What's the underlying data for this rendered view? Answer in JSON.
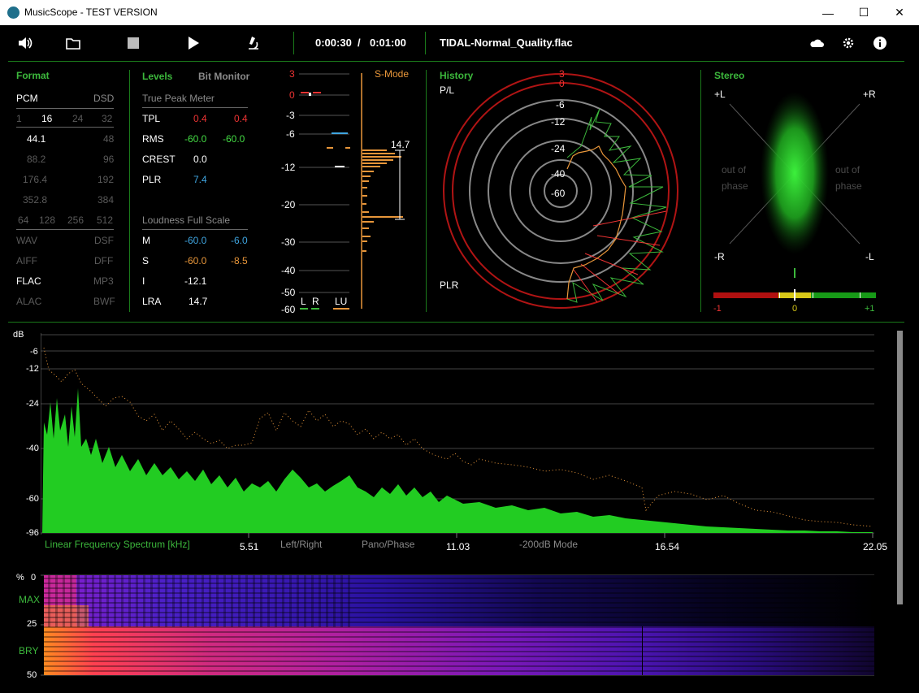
{
  "window": {
    "title": "MusicScope - TEST VERSION",
    "minimize_glyph": "—",
    "maximize_glyph": "☐",
    "close_glyph": "✕"
  },
  "toolbar": {
    "icons": [
      "volume-icon",
      "folder-icon",
      "stop-icon",
      "play-icon",
      "microscope-icon",
      "cloud-icon",
      "gear-icon",
      "info-icon"
    ],
    "position": "0:00:30",
    "separator": "/",
    "duration": "0:01:00",
    "filename": "TIDAL-Normal_Quality.flac"
  },
  "format": {
    "heading": "Format",
    "pcm": "PCM",
    "dsd": "DSD",
    "bits": [
      "1",
      "16",
      "24",
      "32"
    ],
    "rates_left": [
      "44.1",
      "88.2",
      "176.4",
      "352.8"
    ],
    "rates_right": [
      "48",
      "96",
      "192",
      "384"
    ],
    "dsd_rates": [
      "64",
      "128",
      "256",
      "512"
    ],
    "containers_left": [
      "WAV",
      "AIFF",
      "FLAC",
      "ALAC"
    ],
    "containers_right": [
      "DSF",
      "DFF",
      "MP3",
      "BWF"
    ]
  },
  "levels": {
    "heading": "Levels",
    "bit_monitor": "Bit Monitor",
    "true_peak_heading": "True Peak Meter",
    "tpl": {
      "label": "TPL",
      "left": "0.4",
      "right": "0.4"
    },
    "rms": {
      "label": "RMS",
      "left": "-60.0",
      "right": "-60.0"
    },
    "crest": {
      "label": "CREST",
      "value": "0.0"
    },
    "plr": {
      "label": "PLR",
      "value": "7.4"
    },
    "loudness_heading": "Loudness Full Scale",
    "m": {
      "label": "M",
      "left": "-60.0",
      "right": "-6.0"
    },
    "s": {
      "label": "S",
      "left": "-60.0",
      "right": "-8.5"
    },
    "i": {
      "label": "I",
      "value": "-12.1"
    },
    "lra": {
      "label": "LRA",
      "value": "14.7"
    }
  },
  "meter": {
    "smode": "S-Mode",
    "scale": [
      "3",
      "0",
      "-3",
      "-6",
      "-12",
      "-20",
      "-30",
      "-40",
      "-50",
      "-60"
    ],
    "lra_value": "14.7",
    "labels": {
      "l": "L",
      "r": "R",
      "lu": "LU"
    }
  },
  "history": {
    "heading": "History",
    "pl": "P/L",
    "plr": "PLR",
    "rings": [
      "3",
      "0",
      "-6",
      "-12",
      "-24",
      "-40",
      "-60"
    ]
  },
  "stereo": {
    "heading": "Stereo",
    "plus_l": "+L",
    "plus_r": "+R",
    "minus_r": "-R",
    "minus_l": "-L",
    "out_of_phase": "out of phase",
    "corr_min": "-1",
    "corr_mid": "0",
    "corr_max": "+1"
  },
  "spectrum": {
    "db_label": "dB",
    "y_ticks": [
      "-6",
      "-12",
      "-24",
      "-40",
      "-60",
      "-96"
    ],
    "title": "Linear Frequency Spectrum [kHz]",
    "x_ticks": [
      "5.51",
      "11.03",
      "16.54",
      "22.05"
    ],
    "modes": [
      "Left/Right",
      "Pano/Phase",
      "-200dB Mode"
    ]
  },
  "spectrogram": {
    "pct": "%",
    "ticks": [
      "0",
      "25",
      "50"
    ],
    "max_label": "MAX",
    "bry_label": "BRY"
  },
  "colors": {
    "accent": "#3cb83c",
    "orange": "#e8963a",
    "red": "#e33333",
    "blue": "#3fa5e0",
    "green_level": "#44dd44"
  }
}
